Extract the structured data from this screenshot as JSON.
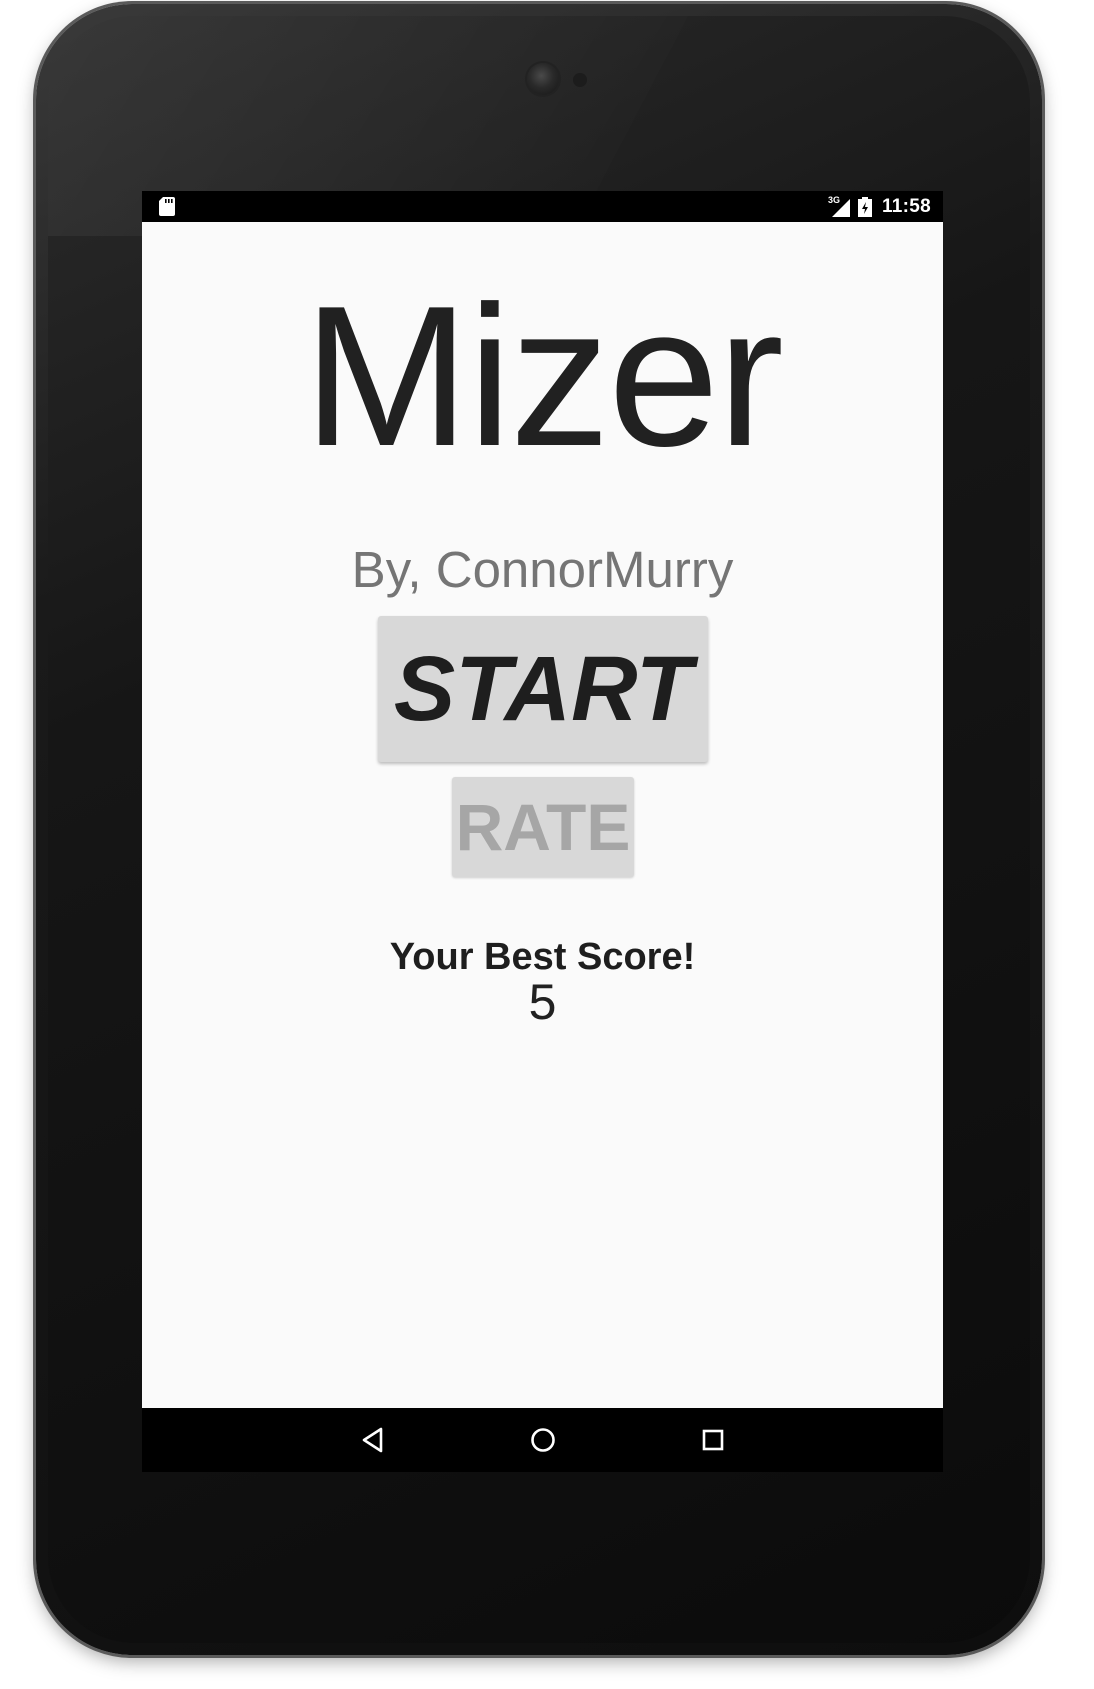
{
  "statusbar": {
    "left_icon": "sd-card-icon",
    "network_label": "3G",
    "time": "11:58"
  },
  "app": {
    "title": "Mizer",
    "author": "By, ConnorMurry",
    "start_label": "START",
    "rate_label": "RATE",
    "best_score_label": "Your Best Score!",
    "best_score_value": "5"
  },
  "navbar": {
    "back_icon": "back-triangle-icon",
    "home_icon": "home-circle-icon",
    "recents_icon": "recents-square-icon"
  },
  "colors": {
    "app_background": "#fafafa",
    "title_text": "#212121",
    "author_text": "#757575",
    "button_background": "#d8d8d8",
    "rate_text": "#a6a6a6",
    "bezel": "#111111"
  }
}
